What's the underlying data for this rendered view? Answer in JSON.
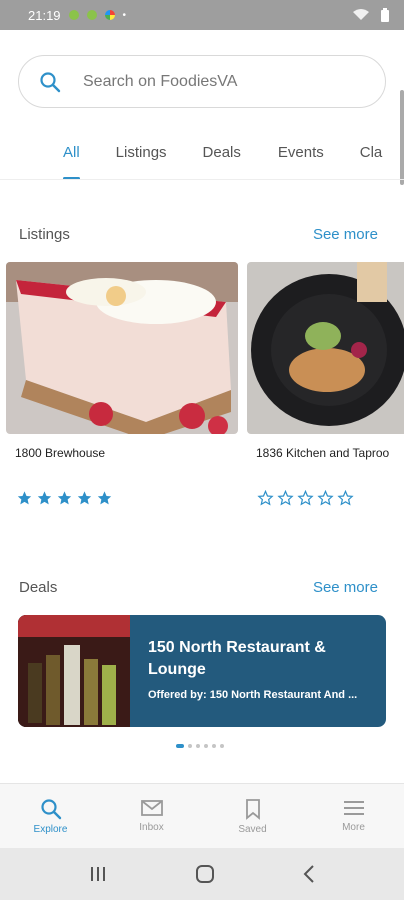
{
  "status_bar": {
    "time": "21:19"
  },
  "search": {
    "placeholder": "Search on FoodiesVA"
  },
  "tabs": [
    {
      "label": "All",
      "active": true
    },
    {
      "label": "Listings"
    },
    {
      "label": "Deals"
    },
    {
      "label": "Events"
    },
    {
      "label": "Cla"
    }
  ],
  "listings_section": {
    "title": "Listings",
    "see_more": "See more",
    "items": [
      {
        "name": "1800 Brewhouse",
        "rating": 5
      },
      {
        "name": "1836 Kitchen and Taproo",
        "rating": 0
      }
    ]
  },
  "deals_section": {
    "title": "Deals",
    "see_more": "See more",
    "deal": {
      "title": "150 North Restaurant & Lounge",
      "offered_by": "Offered by: 150 North Restaurant And ..."
    },
    "pager": {
      "count": 6,
      "active": 0
    }
  },
  "bottom_nav": [
    {
      "label": "Explore",
      "icon": "search-icon",
      "active": true
    },
    {
      "label": "Inbox",
      "icon": "mail-icon"
    },
    {
      "label": "Saved",
      "icon": "bookmark-icon"
    },
    {
      "label": "More",
      "icon": "menu-icon"
    }
  ],
  "colors": {
    "accent": "#2e90c9",
    "deal_bg": "#235a7d"
  }
}
